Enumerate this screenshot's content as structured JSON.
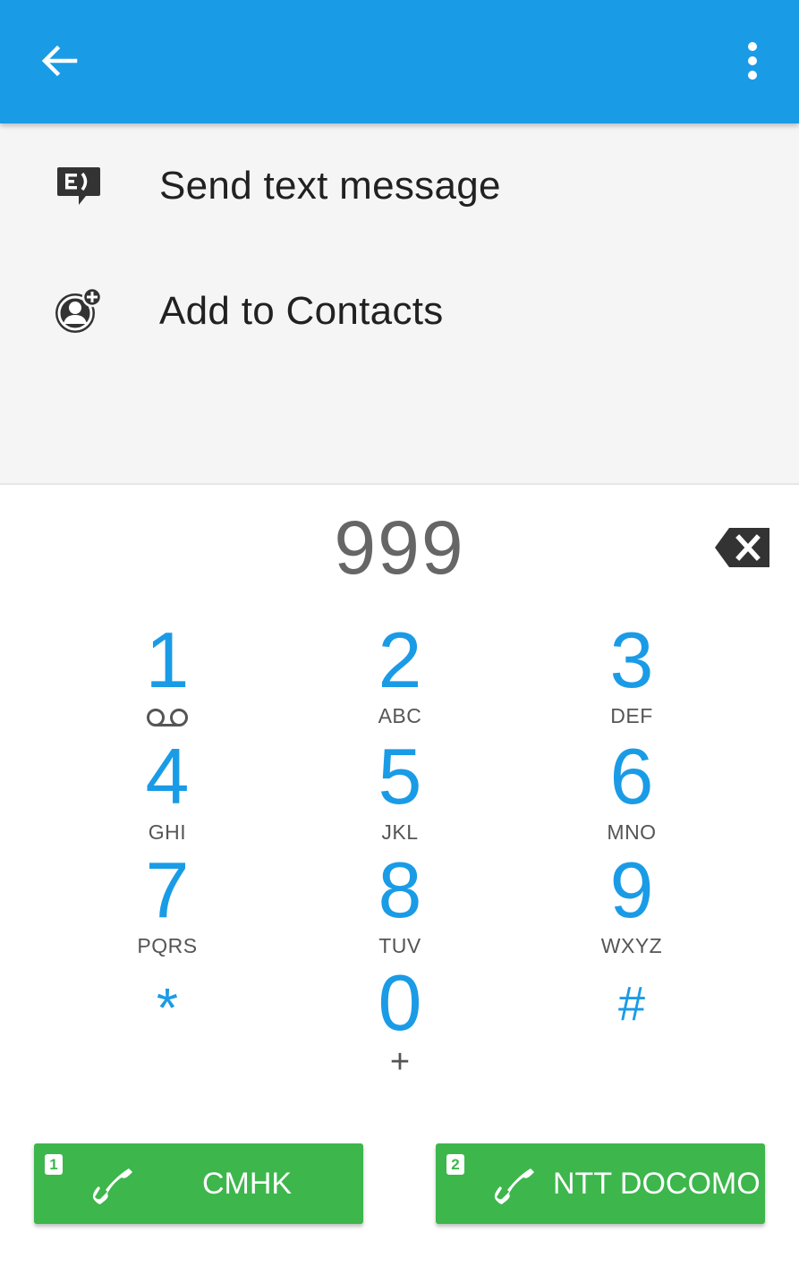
{
  "appbar": {
    "back_icon": "arrow-back-icon",
    "overflow_icon": "more-vert-icon",
    "color": "#1a9be6"
  },
  "actions": [
    {
      "label": "Send text message",
      "icon": "message-icon"
    },
    {
      "label": "Add to Contacts",
      "icon": "add-contact-icon"
    }
  ],
  "dialer": {
    "number": "999",
    "backspace_icon": "backspace-icon",
    "keys": [
      {
        "digit": "1",
        "letters": "",
        "sub_icon": "voicemail-icon"
      },
      {
        "digit": "2",
        "letters": "ABC"
      },
      {
        "digit": "3",
        "letters": "DEF"
      },
      {
        "digit": "4",
        "letters": "GHI"
      },
      {
        "digit": "5",
        "letters": "JKL"
      },
      {
        "digit": "6",
        "letters": "MNO"
      },
      {
        "digit": "7",
        "letters": "PQRS"
      },
      {
        "digit": "8",
        "letters": "TUV"
      },
      {
        "digit": "9",
        "letters": "WXYZ"
      },
      {
        "digit": "*",
        "letters": ""
      },
      {
        "digit": "0",
        "letters": "+"
      },
      {
        "digit": "#",
        "letters": ""
      }
    ]
  },
  "call_buttons": [
    {
      "sim": "1",
      "label": "CMHK",
      "icon": "phone-icon"
    },
    {
      "sim": "2",
      "label": "NTT DOCOMO",
      "icon": "phone-icon"
    }
  ],
  "colors": {
    "accent": "#1a9be6",
    "call_green": "#3db64c"
  }
}
